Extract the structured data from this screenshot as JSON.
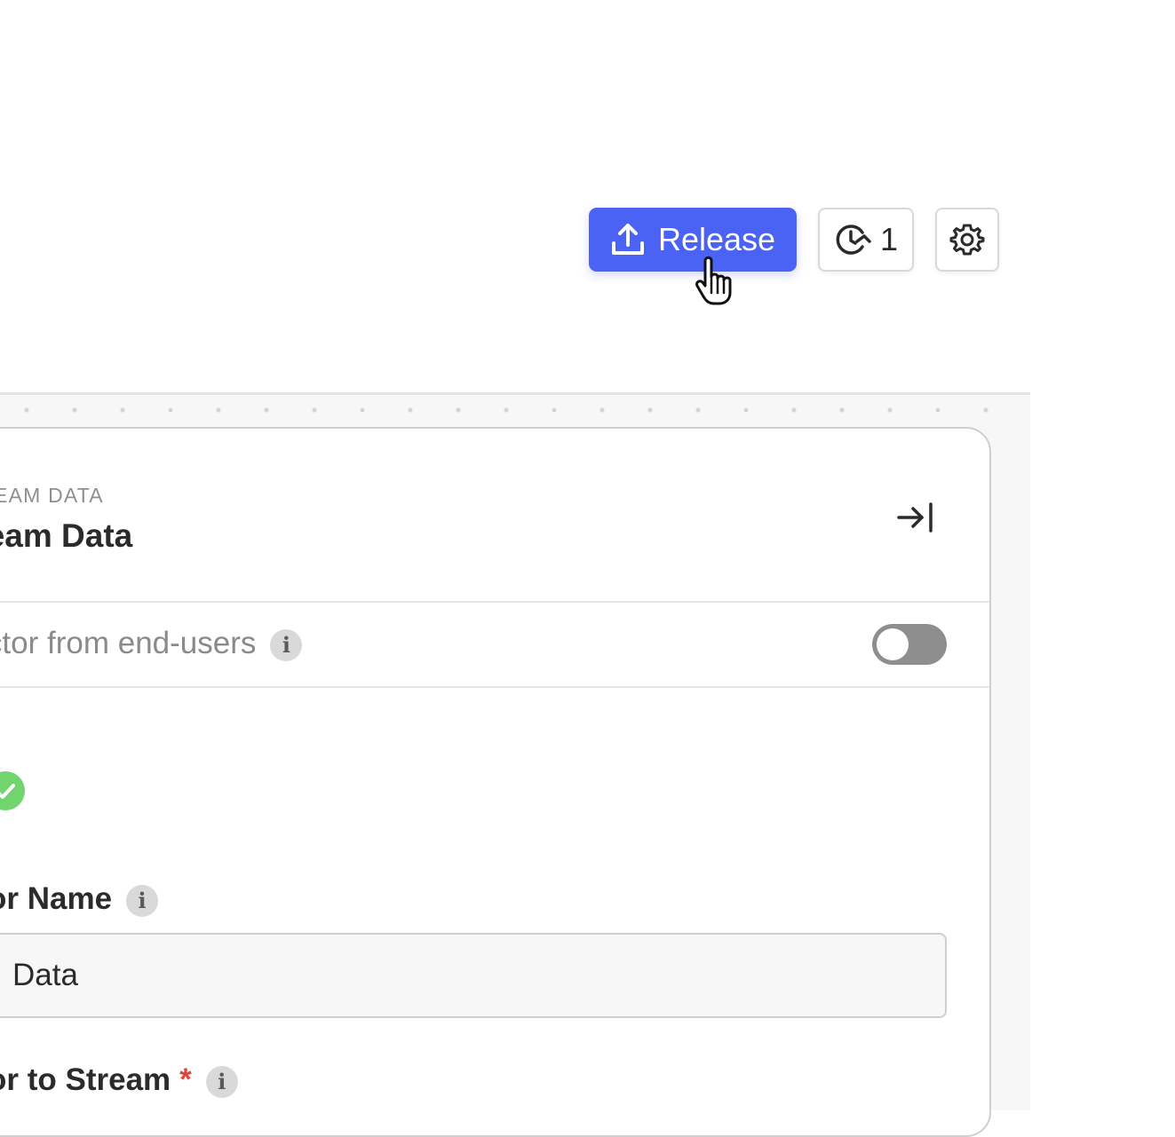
{
  "toolbar": {
    "release_label": "Release",
    "history_count": "1",
    "release_color": "#4a63f5"
  },
  "panel": {
    "eyebrow": "TREAM DATA",
    "title": "tream Data",
    "toggle_label": "nector from end-users",
    "toggle_state": "off",
    "name_label": "or Name",
    "name_value": "Data",
    "stream_label": "or to Stream",
    "required_mark": "*",
    "info_glyph": "i"
  },
  "icons": {
    "release": "upload-icon",
    "history": "history-icon",
    "settings": "gear-icon",
    "collapse": "collapse-right-icon",
    "status": "check-circle-icon",
    "cursor": "hand-pointer-cursor"
  }
}
